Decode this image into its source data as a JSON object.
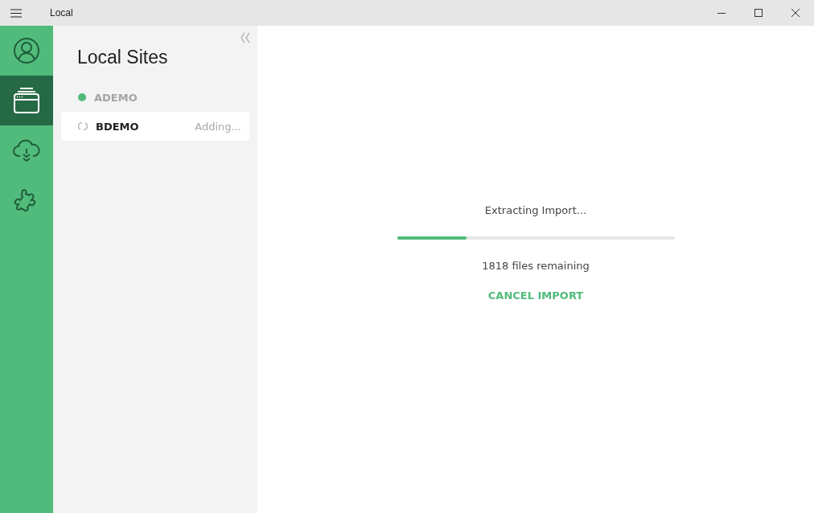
{
  "window": {
    "title": "Local"
  },
  "nav": [
    {
      "kind": "user",
      "selected": false
    },
    {
      "kind": "sites",
      "selected": true
    },
    {
      "kind": "cloud",
      "selected": false
    },
    {
      "kind": "addons",
      "selected": false
    }
  ],
  "sidebar": {
    "title": "Local Sites",
    "sites": [
      {
        "name": "ADEMO",
        "kind": "running",
        "selected": false
      },
      {
        "name": "BDEMO",
        "kind": "adding",
        "status": "Adding...",
        "selected": true
      }
    ]
  },
  "import": {
    "message": "Extracting Import...",
    "level": 0.25,
    "remaining": "1818 files remaining",
    "cancel": "CANCEL IMPORT"
  }
}
